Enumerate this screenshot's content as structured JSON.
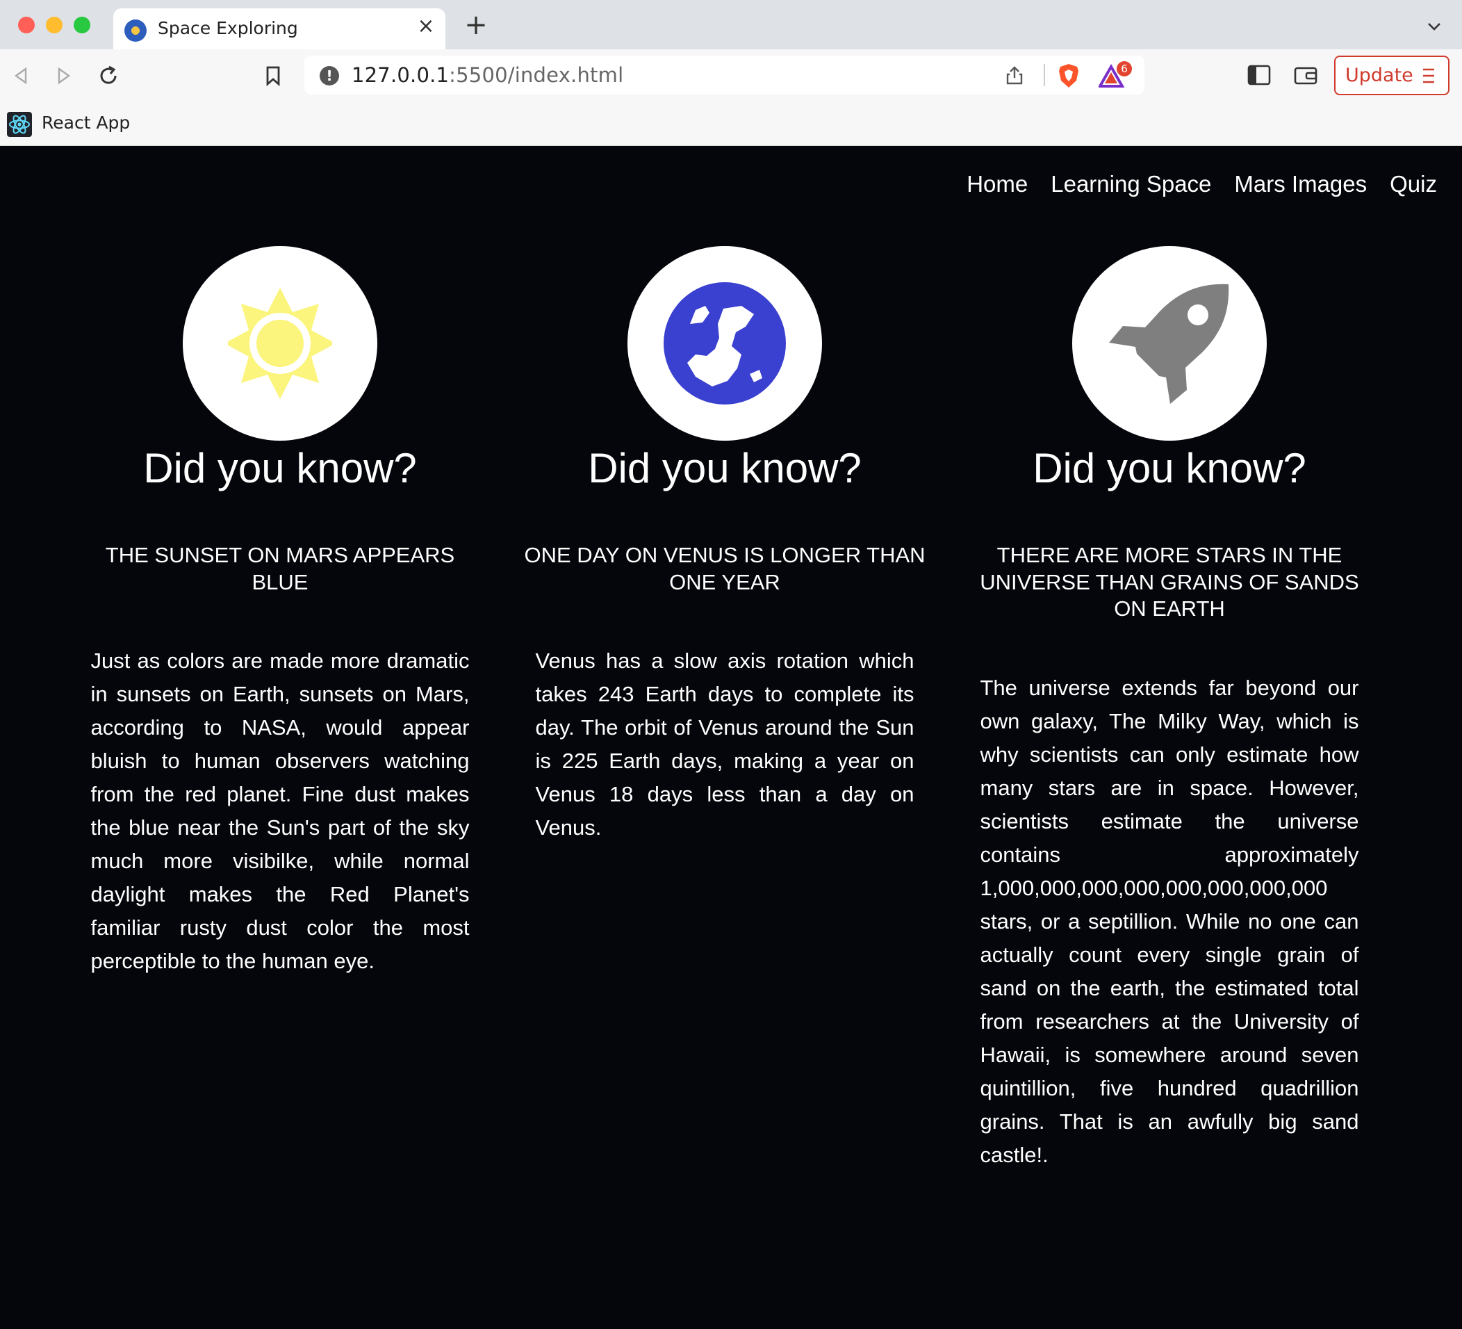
{
  "browser": {
    "tab_title": "Space Exploring",
    "close_glyph": "×",
    "newtab_glyph": "+",
    "url_host": "127.0.0.1",
    "url_rest": ":5500/index.html",
    "info_glyph": "!",
    "rewards_badge": "6",
    "update_label": "Update",
    "bookmark_label": "React App"
  },
  "nav": {
    "items": [
      "Home",
      "Learning Space",
      "Mars Images",
      "Quiz"
    ]
  },
  "cards": [
    {
      "icon": "sun-icon",
      "heading": "Did you know?",
      "subheading": "THE SUNSET ON MARS APPEARS BLUE",
      "body": "Just as colors are made more dramatic in sunsets on Earth, sunsets on Mars, according to NASA, would appear bluish to human observers watching from the red planet. Fine dust makes the blue near the Sun's part of the sky much more visibilke, while normal daylight makes the Red Planet's familiar rusty dust color the most perceptible to the human eye."
    },
    {
      "icon": "earth-globe-icon",
      "heading": "Did you know?",
      "subheading": "ONE DAY ON VENUS IS LONGER THAN ONE YEAR",
      "body": "Venus has a slow axis rotation which takes 243 Earth days to complete its day. The orbit of Venus around the Sun is 225 Earth days, making a year on Venus 18 days less than a day on Venus."
    },
    {
      "icon": "rocket-icon",
      "heading": "Did you know?",
      "subheading": "THERE ARE MORE STARS IN THE UNIVERSE THAN GRAINS OF SANDS ON EARTH",
      "body": "The universe extends far beyond our own galaxy, The Milky Way, which is why scientists can only estimate how many stars are in space. However, scientists estimate the universe contains approximately 1,000,000,000,000,000,000,000,000 stars, or a septillion. While no one can actually count every single grain of sand on the earth, the estimated total from researchers at the University of Hawaii, is somewhere around seven quintillion, five hundred quadrillion grains. That is an awfully big sand castle!."
    }
  ],
  "colors": {
    "page_bg": "#05060b",
    "sun": "#fbf57d",
    "earth": "#3a40cf",
    "rocket": "#7f7f7f",
    "update_accent": "#cf3b2d"
  }
}
